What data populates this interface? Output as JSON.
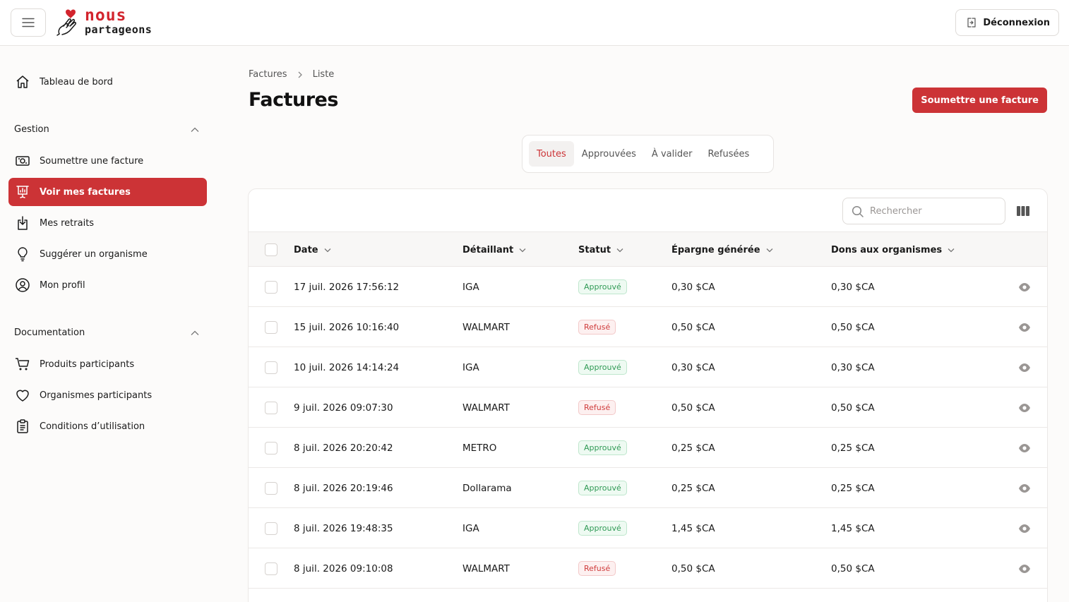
{
  "header": {
    "logo_line1": "nous",
    "logo_line2": "partageons",
    "logout_label": "Déconnexion"
  },
  "sidebar": {
    "dashboard": "Tableau de bord",
    "section_gestion": "Gestion",
    "gestion_items": [
      {
        "label": "Soumettre une facture",
        "icon": "invoice-upload-icon"
      },
      {
        "label": "Voir mes factures",
        "icon": "invoice-list-icon",
        "active": true
      },
      {
        "label": "Mes retraits",
        "icon": "withdraw-icon"
      },
      {
        "label": "Suggérer un organisme",
        "icon": "lightbulb-icon"
      },
      {
        "label": "Mon profil",
        "icon": "user-circle-icon"
      }
    ],
    "section_documentation": "Documentation",
    "documentation_items": [
      {
        "label": "Produits participants",
        "icon": "cart-icon"
      },
      {
        "label": "Organismes participants",
        "icon": "heart-icon"
      },
      {
        "label": "Conditions d’utilisation",
        "icon": "clipboard-icon"
      }
    ]
  },
  "main": {
    "breadcrumb": [
      "Factures",
      "Liste"
    ],
    "title": "Factures",
    "submit_button": "Soumettre une facture",
    "tabs": [
      "Toutes",
      "Approuvées",
      "À valider",
      "Refusées"
    ],
    "search_placeholder": "Rechercher"
  },
  "table": {
    "columns": [
      "Date",
      "Détaillant",
      "Statut",
      "Épargne générée",
      "Dons aux organismes"
    ],
    "rows": [
      {
        "date": "17 juil. 2026 17:56:12",
        "retailer": "IGA",
        "status": "Approuvé",
        "savings": "0,30 $CA",
        "donations": "0,30 $CA"
      },
      {
        "date": "15 juil. 2026 10:16:40",
        "retailer": "WALMART",
        "status": "Refusé",
        "savings": "0,50 $CA",
        "donations": "0,50 $CA"
      },
      {
        "date": "10 juil. 2026 14:14:24",
        "retailer": "IGA",
        "status": "Approuvé",
        "savings": "0,30 $CA",
        "donations": "0,30 $CA"
      },
      {
        "date": "9 juil. 2026 09:07:30",
        "retailer": "WALMART",
        "status": "Refusé",
        "savings": "0,50 $CA",
        "donations": "0,50 $CA"
      },
      {
        "date": "8 juil. 2026 20:20:42",
        "retailer": "METRO",
        "status": "Approuvé",
        "savings": "0,25 $CA",
        "donations": "0,25 $CA"
      },
      {
        "date": "8 juil. 2026 20:19:46",
        "retailer": "Dollarama",
        "status": "Approuvé",
        "savings": "0,25 $CA",
        "donations": "0,25 $CA"
      },
      {
        "date": "8 juil. 2026 19:48:35",
        "retailer": "IGA",
        "status": "Approuvé",
        "savings": "1,45 $CA",
        "donations": "1,45 $CA"
      },
      {
        "date": "8 juil. 2026 09:10:08",
        "retailer": "WALMART",
        "status": "Refusé",
        "savings": "0,50 $CA",
        "donations": "0,50 $CA"
      }
    ]
  },
  "colors": {
    "brand": "#cc3336",
    "approved": "#2f9a55",
    "refused": "#cf3b3b"
  }
}
